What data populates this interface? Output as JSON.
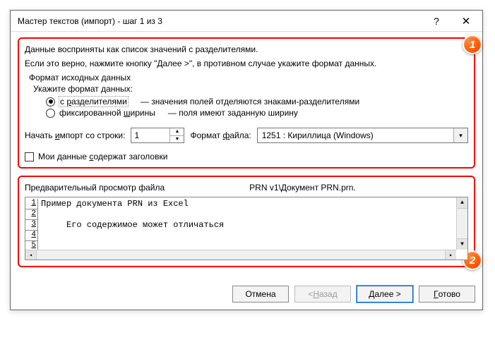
{
  "titlebar": {
    "title": "Мастер текстов (импорт) - шаг 1 из 3",
    "help": "?",
    "close": "✕"
  },
  "badges": {
    "one": "1",
    "two": "2"
  },
  "info": {
    "line1": "Данные восприняты как список значений с разделителями.",
    "line2": "Если это верно, нажмите кнопку \"Далее >\", в противном случае укажите формат данных."
  },
  "source": {
    "group": "Формат исходных данных",
    "prompt": "Укажите формат данных:",
    "opt_delim_pre": "с ",
    "opt_delim_u": "р",
    "opt_delim_post": "азделителями",
    "opt_delim_desc": "— значения полей отделяются знаками-разделителями",
    "opt_fixed_pre": "фиксированной ",
    "opt_fixed_u": "ш",
    "opt_fixed_post": "ирины",
    "opt_fixed_desc": "— поля имеют заданную ширину"
  },
  "import": {
    "start_pre": "Начать ",
    "start_u": "и",
    "start_post": "мпорт со строки:",
    "start_value": "1",
    "format_pre": "Формат ",
    "format_u": "ф",
    "format_post": "айла:",
    "format_value": "1251 : Кириллица (Windows)"
  },
  "headers": {
    "pre": "Мои данные ",
    "u": "с",
    "post": "одержат заголовки"
  },
  "preview": {
    "label_prefix": "Предварительный просмотр файла",
    "label_path": "                                    PRN v1\\Документ PRN.prn.",
    "rows": [
      "Пример документа PRN из Excel",
      "",
      "     Его содержимое может отличаться",
      "",
      ""
    ]
  },
  "buttons": {
    "cancel": "Отмена",
    "back_pre": "< ",
    "back_u": "Н",
    "back_post": "азад",
    "next_u": "Д",
    "next_post": "алее >",
    "finish_u": "Г",
    "finish_post": "отово"
  }
}
